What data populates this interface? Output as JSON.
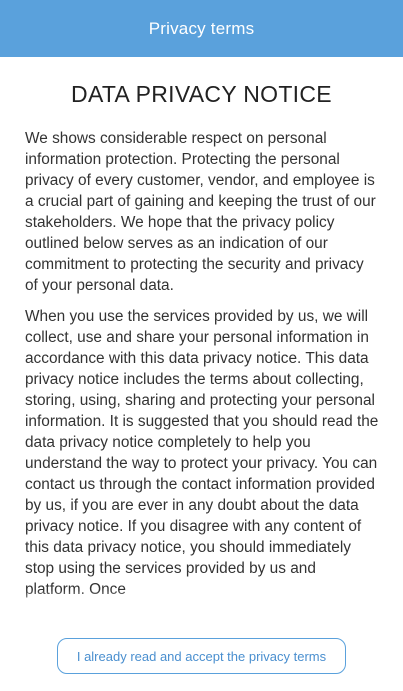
{
  "header": {
    "title": "Privacy terms"
  },
  "notice": {
    "title": "DATA PRIVACY NOTICE",
    "paragraphs": [
      "We shows considerable respect on personal information protection. Protecting the personal privacy of every customer, vendor, and employee is a crucial part of gaining and keeping the trust of our stakeholders. We hope that the privacy policy outlined below serves as an indication of our commitment to protecting the security and privacy of your personal data.",
      "When you use the services provided by us, we will collect, use and share your personal information in accordance with this data privacy notice. This data privacy notice includes the terms about collecting, storing, using, sharing and protecting your personal information. It is suggested that you should read the data privacy notice completely to help you understand the way to protect your privacy. You can contact us through the contact information provided by us, if you are ever in any doubt about the data privacy notice. If you disagree with any content of this data privacy notice, you should immediately stop using the services provided by us and platform. Once"
    ]
  },
  "footer": {
    "accept_label": "I already read and accept the privacy terms"
  }
}
